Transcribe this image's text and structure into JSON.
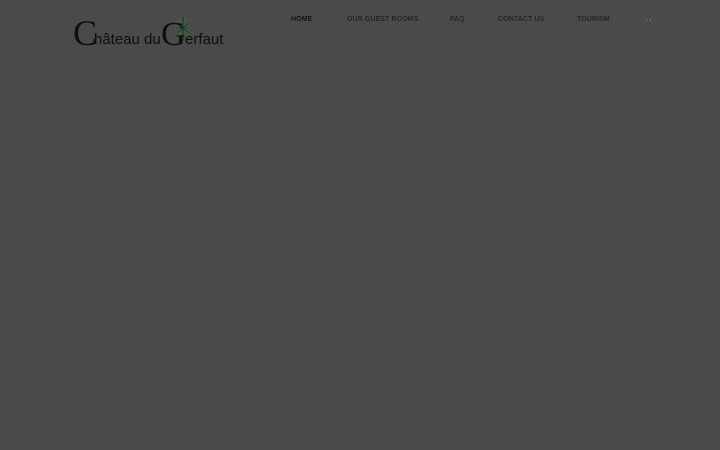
{
  "header": {
    "logo": {
      "text_part1": "Château du",
      "initial": "G",
      "text_part2": "erfaut",
      "icon": "tree-emblem-icon"
    },
    "nav": {
      "items": [
        {
          "label": "HOME",
          "active": true
        },
        {
          "label": "OUR GUEST ROOMS",
          "active": false
        },
        {
          "label": "FAQ",
          "active": false
        },
        {
          "label": "CONTACT US",
          "active": false
        },
        {
          "label": "TOURISM",
          "active": false
        }
      ],
      "language_icon": "uk-flag-icon"
    }
  },
  "colors": {
    "overlay_background": "#4a4a4a",
    "nav_text": "#2a2a2a",
    "logo_text": "#0e0e0e",
    "emblem_green": "#3f5a47"
  }
}
